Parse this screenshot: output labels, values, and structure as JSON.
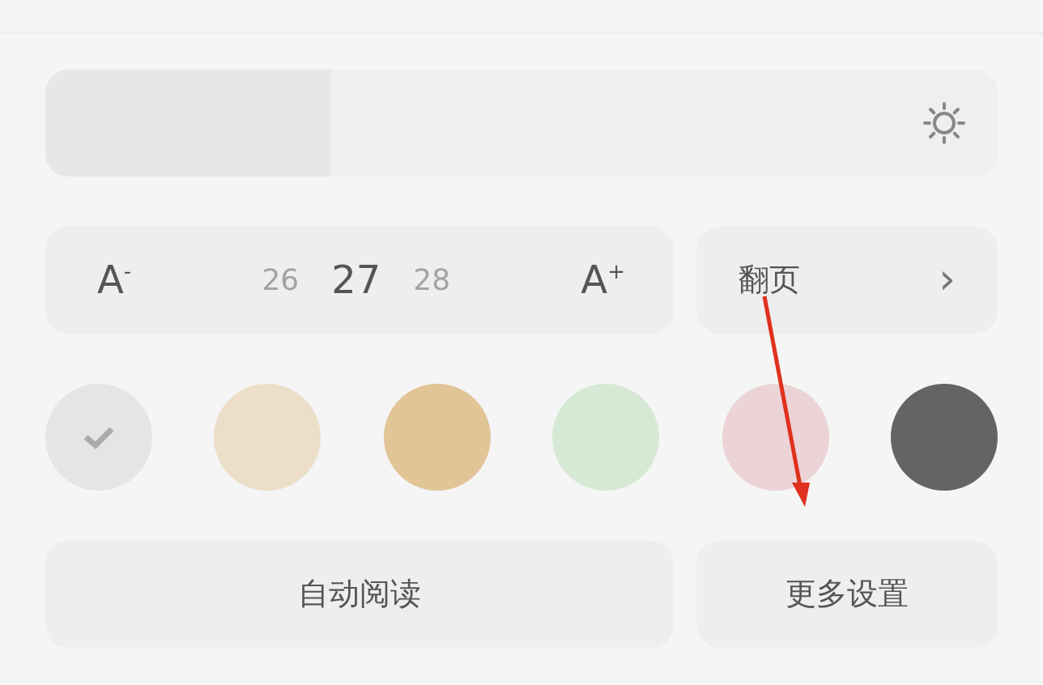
{
  "brightness": {
    "level": 0.3
  },
  "font_size": {
    "decrease": "A$^{-}$",
    "increase": "A$^{+}$",
    "sizes": [
      {
        "label": "26",
        "selected": false
      },
      {
        "label": "27",
        "selected": true
      },
      {
        "label": "28",
        "selected": false
      }
    ]
  },
  "page_turn": {
    "label": "翻页",
    "chevron": "›"
  },
  "themes": [
    {
      "color": "#e5e5e5",
      "selected": true
    },
    {
      "color": "#ecdec8",
      "selected": false
    },
    {
      "color": "#e1c597",
      "selected": false
    },
    {
      "color": "#d6e9d4",
      "selected": false
    },
    {
      "color": "#ebd3d6",
      "selected": false
    },
    {
      "color": "#646464",
      "selected": false
    }
  ],
  "buttons": [
    "自动阅读",
    "更多设置"
  ]
}
